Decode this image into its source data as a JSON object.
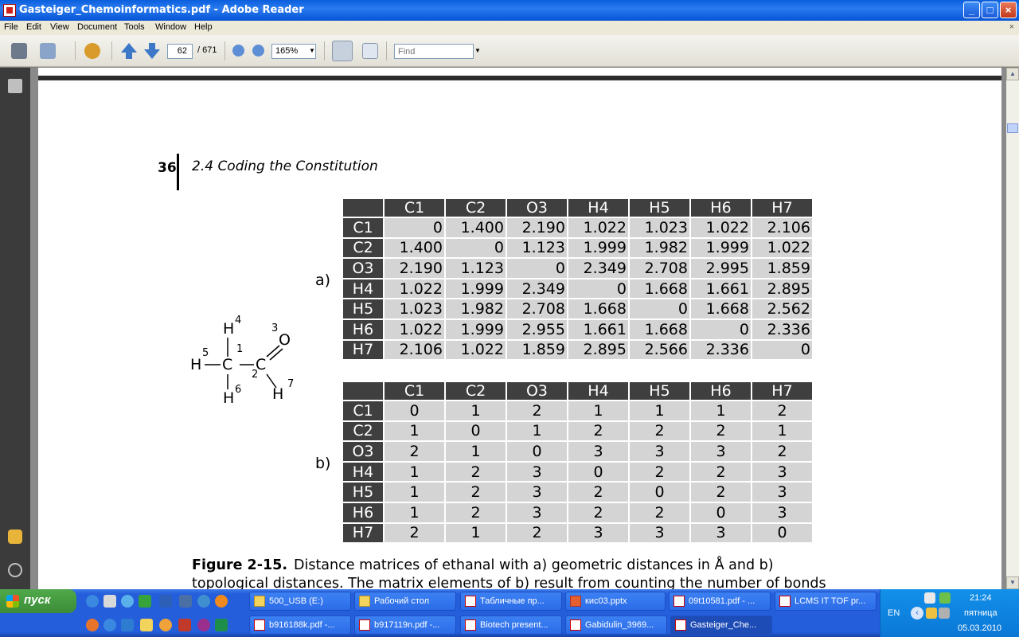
{
  "window": {
    "title": "Gasteiger_Chemoinformatics.pdf - Adobe Reader",
    "minimize": "_",
    "maximize": "□",
    "close": "×"
  },
  "menu": [
    "File",
    "Edit",
    "View",
    "Document",
    "Tools",
    "Window",
    "Help"
  ],
  "menu_close": "×",
  "toolbar": {
    "page_current": "62",
    "page_total": "/ 671",
    "zoom": "165%",
    "find_placeholder": "Find"
  },
  "page": {
    "number": "36",
    "section": "2.4  Coding the Constitution",
    "label_a": "a)",
    "label_b": "b)",
    "caption_label": "Figure 2-15.",
    "caption_text": "Distance matrices of ethanal with a) geometric distances in Å and b) topological distances. The matrix elements of b) result from counting the number of bonds along the"
  },
  "molecule": {
    "atoms": [
      "H",
      "H",
      "C",
      "C",
      "O",
      "H",
      "H"
    ],
    "indices": [
      "4",
      "5",
      "1",
      "3",
      "2",
      "6",
      "7"
    ]
  },
  "matrix_a": {
    "headers": [
      "C1",
      "C2",
      "O3",
      "H4",
      "H5",
      "H6",
      "H7"
    ],
    "rows": [
      {
        "label": "C1",
        "values": [
          "0",
          "1.400",
          "2.190",
          "1.022",
          "1.023",
          "1.022",
          "2.106"
        ]
      },
      {
        "label": "C2",
        "values": [
          "1.400",
          "0",
          "1.123",
          "1.999",
          "1.982",
          "1.999",
          "1.022"
        ]
      },
      {
        "label": "O3",
        "values": [
          "2.190",
          "1.123",
          "0",
          "2.349",
          "2.708",
          "2.995",
          "1.859"
        ]
      },
      {
        "label": "H4",
        "values": [
          "1.022",
          "1.999",
          "2.349",
          "0",
          "1.668",
          "1.661",
          "2.895"
        ]
      },
      {
        "label": "H5",
        "values": [
          "1.023",
          "1.982",
          "2.708",
          "1.668",
          "0",
          "1.668",
          "2.562"
        ]
      },
      {
        "label": "H6",
        "values": [
          "1.022",
          "1.999",
          "2.955",
          "1.661",
          "1.668",
          "0",
          "2.336"
        ]
      },
      {
        "label": "H7",
        "values": [
          "2.106",
          "1.022",
          "1.859",
          "2.895",
          "2.566",
          "2.336",
          "0"
        ]
      }
    ]
  },
  "matrix_b": {
    "headers": [
      "C1",
      "C2",
      "O3",
      "H4",
      "H5",
      "H6",
      "H7"
    ],
    "rows": [
      {
        "label": "C1",
        "values": [
          "0",
          "1",
          "2",
          "1",
          "1",
          "1",
          "2"
        ]
      },
      {
        "label": "C2",
        "values": [
          "1",
          "0",
          "1",
          "2",
          "2",
          "2",
          "1"
        ]
      },
      {
        "label": "O3",
        "values": [
          "2",
          "1",
          "0",
          "3",
          "3",
          "3",
          "2"
        ]
      },
      {
        "label": "H4",
        "values": [
          "1",
          "2",
          "3",
          "0",
          "2",
          "2",
          "3"
        ]
      },
      {
        "label": "H5",
        "values": [
          "1",
          "2",
          "3",
          "2",
          "0",
          "2",
          "3"
        ]
      },
      {
        "label": "H6",
        "values": [
          "1",
          "2",
          "3",
          "2",
          "2",
          "0",
          "3"
        ]
      },
      {
        "label": "H7",
        "values": [
          "2",
          "1",
          "2",
          "3",
          "3",
          "3",
          "0"
        ]
      }
    ]
  },
  "taskbar": {
    "start_label": "пуск",
    "row1": [
      {
        "label": "500_USB (E:)",
        "icon": "folder"
      },
      {
        "label": "Рабочий стол",
        "icon": "folder"
      },
      {
        "label": "Табличные пр...",
        "icon": "pdf"
      },
      {
        "label": "кис03.pptx",
        "icon": "ppt"
      },
      {
        "label": "09t10581.pdf - ...",
        "icon": "pdf"
      },
      {
        "label": "LCMS IT TOF pr...",
        "icon": "pdf"
      }
    ],
    "row2": [
      {
        "label": "b916188k.pdf -...",
        "icon": "pdf"
      },
      {
        "label": "b917119n.pdf -...",
        "icon": "pdf"
      },
      {
        "label": "Biotech present...",
        "icon": "pdf"
      },
      {
        "label": "Gabidulin_3969...",
        "icon": "pdf"
      },
      {
        "label": "Gasteiger_Che...",
        "icon": "pdf",
        "active": true
      }
    ],
    "tray": {
      "lang": "EN",
      "time": "21:24",
      "day": "пятница",
      "date": "05.03.2010"
    }
  }
}
